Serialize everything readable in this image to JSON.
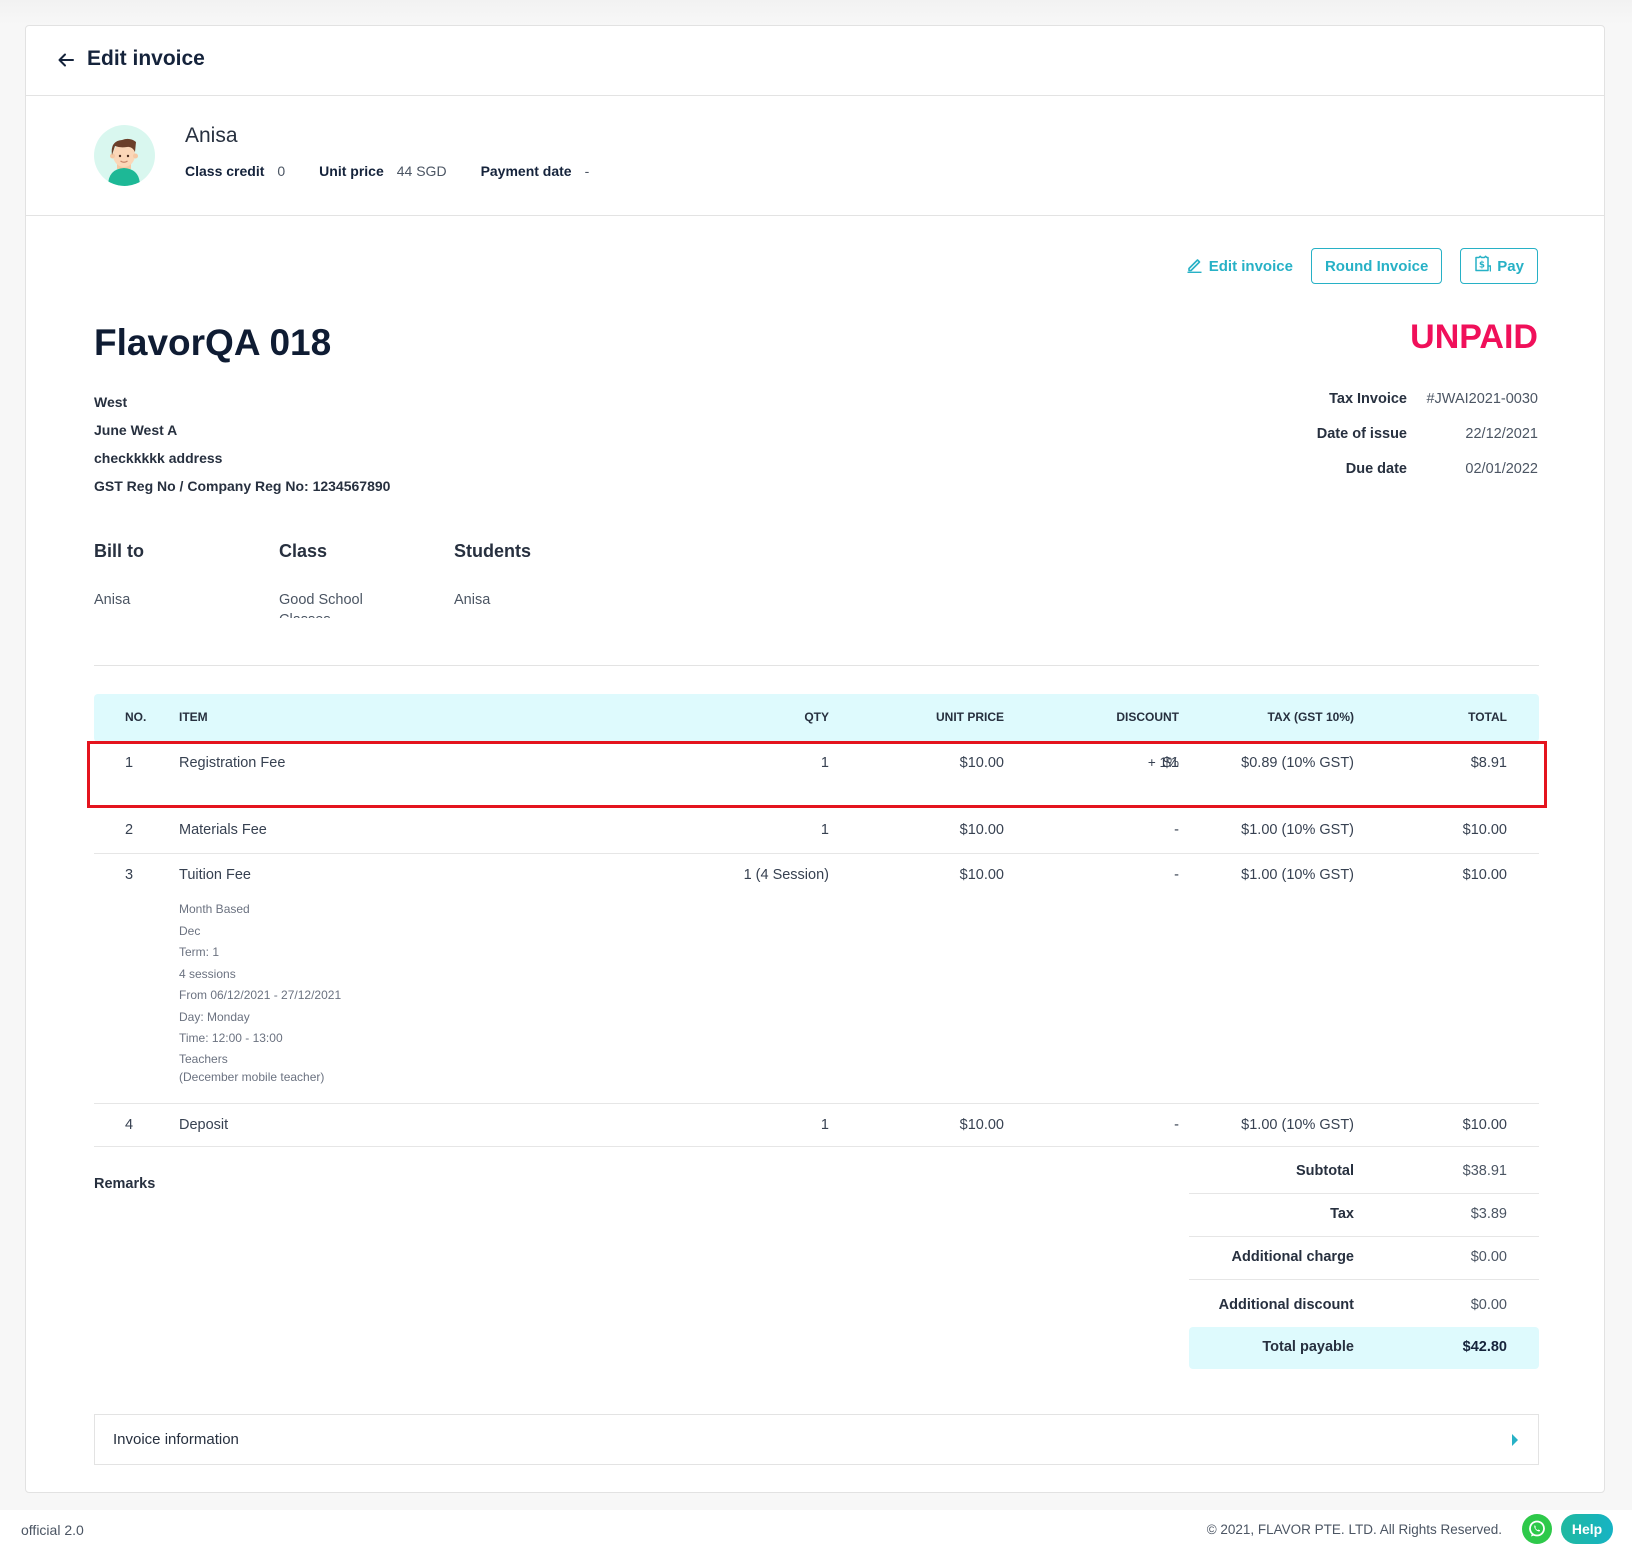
{
  "header": {
    "title": "Edit invoice",
    "back_icon": "arrow-left-icon"
  },
  "profile": {
    "name": "Anisa",
    "class_credit_label": "Class credit",
    "class_credit_value": "0",
    "unit_price_label": "Unit price",
    "unit_price_value": "44 SGD",
    "payment_date_label": "Payment date",
    "payment_date_value": "-"
  },
  "actions": {
    "edit_invoice": "Edit invoice",
    "round_invoice": "Round Invoice",
    "pay": "Pay"
  },
  "invoice": {
    "company": "FlavorQA 018",
    "status": "UNPAID",
    "status_color": "#f0105a",
    "address_lines": [
      "West",
      "June West A",
      "checkkkkk address",
      "GST Reg No / Company Reg No: 1234567890"
    ],
    "meta": [
      {
        "label": "Tax Invoice",
        "value": "#JWAI2021-0030"
      },
      {
        "label": "Date of issue",
        "value": "22/12/2021"
      },
      {
        "label": "Due date",
        "value": "02/01/2022"
      }
    ],
    "bill_to_label": "Bill to",
    "bill_to_value": "Anisa",
    "class_label": "Class",
    "class_value": "Good School Classes",
    "students_label": "Students",
    "students_value": "Anisa"
  },
  "table": {
    "columns": [
      "NO.",
      "ITEM",
      "QTY",
      "UNIT PRICE",
      "DISCOUNT",
      "TAX (GST 10%)",
      "TOTAL"
    ],
    "rows": [
      {
        "no": "1",
        "item": "Registration Fee",
        "qty": "1",
        "unit_price": "$10.00",
        "discount": "$1",
        "discount_extra": "+  1%",
        "tax": "$0.89 (10% GST)",
        "total": "$8.91",
        "highlighted": true
      },
      {
        "no": "2",
        "item": "Materials Fee",
        "qty": "1",
        "unit_price": "$10.00",
        "discount": "-",
        "tax": "$1.00 (10% GST)",
        "total": "$10.00"
      },
      {
        "no": "3",
        "item": "Tuition Fee",
        "qty": "1 (4 Session)",
        "unit_price": "$10.00",
        "discount": "-",
        "tax": "$1.00 (10% GST)",
        "total": "$10.00",
        "details": [
          "Month Based",
          "Dec",
          "Term: 1",
          "4 sessions",
          "From 06/12/2021 - 27/12/2021",
          "Day: Monday",
          "Time: 12:00 - 13:00",
          "Teachers",
          "(December mobile teacher)"
        ]
      },
      {
        "no": "4",
        "item": "Deposit",
        "qty": "1",
        "unit_price": "$10.00",
        "discount": "-",
        "tax": "$1.00 (10% GST)",
        "total": "$10.00"
      }
    ]
  },
  "remarks_label": "Remarks",
  "summary": {
    "subtotal_label": "Subtotal",
    "subtotal": "$38.91",
    "tax_label": "Tax",
    "tax": "$3.89",
    "additional_charge_label": "Additional charge",
    "additional_charge": "$0.00",
    "additional_discount_label": "Additional discount",
    "additional_discount": "$0.00",
    "total_label": "Total payable",
    "total": "$42.80"
  },
  "invoice_information_label": "Invoice information",
  "footer": {
    "version": "official 2.0",
    "copyright": "© 2021, FLAVOR PTE. LTD. All Rights Reserved.",
    "help": "Help"
  },
  "colors": {
    "accent": "#27b1c6",
    "header_band": "#defafd",
    "highlight": "#e4141e"
  }
}
